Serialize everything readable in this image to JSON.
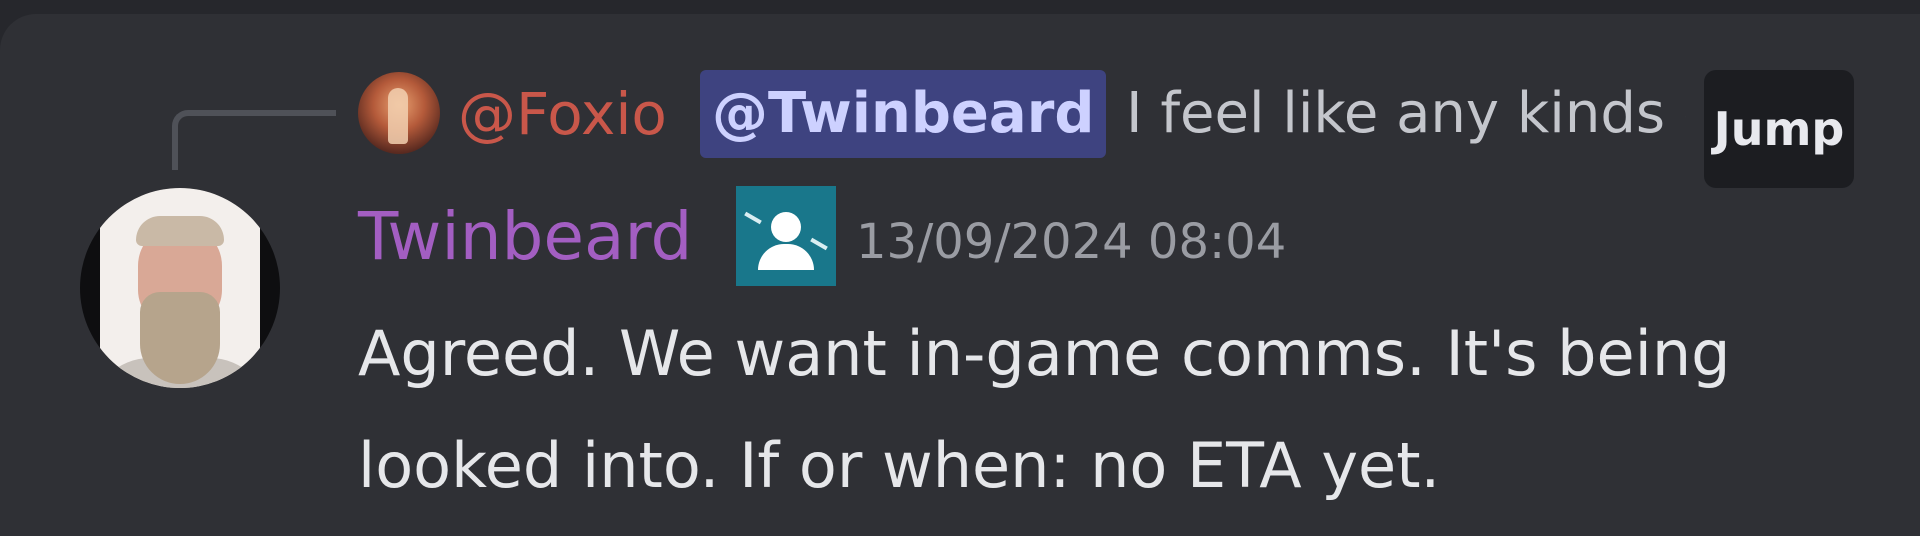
{
  "reply": {
    "author": "@Foxio",
    "mention": "@Twinbeard",
    "preview": "I feel like any kinds o"
  },
  "tooltip": {
    "label": "Jump"
  },
  "message": {
    "author": "Twinbeard",
    "timestamp": "13/09/2024 08:04",
    "content": "Agreed. We want in-game comms. It's being looked into. If or when: no ETA yet."
  },
  "colors": {
    "author": "#a35ec2",
    "reply_author": "#c9574a",
    "mention_bg": "#3e4380",
    "role_icon_bg": "#19778b",
    "background": "#2f3035"
  },
  "icons": {
    "role_icon": "user-role-icon",
    "reply_avatar": "foxio-avatar",
    "author_avatar": "twinbeard-avatar"
  }
}
